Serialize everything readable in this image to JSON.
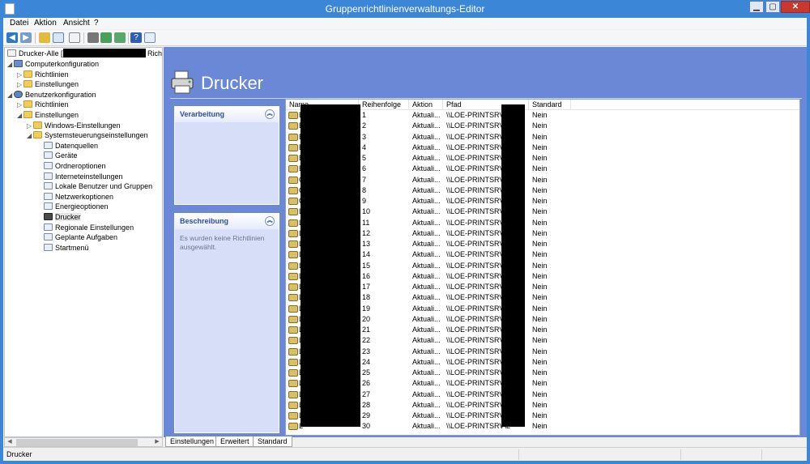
{
  "window": {
    "title": "Gruppenrichtlinienverwaltungs-Editor",
    "minimize": "▁",
    "maximize": "▢",
    "close": "✕"
  },
  "menu": {
    "items": [
      "Datei",
      "Aktion",
      "Ansicht",
      "?"
    ]
  },
  "toolbar": {
    "icons": [
      "back-icon",
      "forward-icon",
      "up-folder-icon",
      "show-hide-tree-icon",
      "clipboard-icon",
      "print-icon",
      "refresh-icon",
      "export-icon",
      "help-icon",
      "properties-icon"
    ]
  },
  "tree": {
    "root_prefix": "Drucker-Alle [",
    "root_suffix": "Richtli",
    "items": [
      {
        "label": "Computerkonfiguration",
        "icon": "computer-icon"
      },
      {
        "label": "Richtlinien",
        "icon": "folder-icon"
      },
      {
        "label": "Einstellungen",
        "icon": "folder-icon"
      },
      {
        "label": "Benutzerkonfiguration",
        "icon": "user-icon"
      },
      {
        "label": "Richtlinien",
        "icon": "folder-icon"
      },
      {
        "label": "Einstellungen",
        "icon": "folder-icon"
      },
      {
        "label": "Windows-Einstellungen",
        "icon": "folder-icon"
      },
      {
        "label": "Systemsteuerungseinstellungen",
        "icon": "folder-icon"
      },
      {
        "label": "Datenquellen",
        "icon": "datasource-icon"
      },
      {
        "label": "Geräte",
        "icon": "devices-icon"
      },
      {
        "label": "Ordneroptionen",
        "icon": "folder-options-icon"
      },
      {
        "label": "Interneteinstellungen",
        "icon": "internet-icon"
      },
      {
        "label": "Lokale Benutzer und Gruppen",
        "icon": "users-icon"
      },
      {
        "label": "Netzwerkoptionen",
        "icon": "network-icon"
      },
      {
        "label": "Energieoptionen",
        "icon": "power-icon"
      },
      {
        "label": "Drucker",
        "icon": "printer-icon"
      },
      {
        "label": "Regionale Einstellungen",
        "icon": "globe-icon"
      },
      {
        "label": "Geplante Aufgaben",
        "icon": "tasks-icon"
      },
      {
        "label": "Startmenü",
        "icon": "startmenu-icon"
      }
    ]
  },
  "content": {
    "title": "Drucker",
    "panels": {
      "processing_title": "Verarbeitung",
      "description_title": "Beschreibung",
      "description_text": "Es wurden keine Richtlinien ausgewählt."
    },
    "columns": [
      "Name",
      "Reihenfolge",
      "Aktion",
      "Pfad",
      "Standard"
    ],
    "rows": [
      {
        "name_initial": "B",
        "order": "1",
        "action": "Aktuali...",
        "path": "\\\\LOE-PRINTSRV\\B",
        "default": "Nein"
      },
      {
        "name_initial": "B",
        "order": "2",
        "action": "Aktuali...",
        "path": "\\\\LOE-PRINTSRV\\B",
        "default": "Nein"
      },
      {
        "name_initial": "B",
        "order": "3",
        "action": "Aktuali...",
        "path": "\\\\LOE-PRINTSRV\\B",
        "default": "Nein"
      },
      {
        "name_initial": "B",
        "order": "4",
        "action": "Aktuali...",
        "path": "\\\\LOE-PRINTSRV\\B",
        "default": "Nein"
      },
      {
        "name_initial": "B",
        "order": "5",
        "action": "Aktuali...",
        "path": "\\\\LOE-PRINTSRV\\B",
        "default": "Nein"
      },
      {
        "name_initial": "B",
        "order": "6",
        "action": "Aktuali...",
        "path": "\\\\LOE-PRINTSRV\\B",
        "default": "Nein"
      },
      {
        "name_initial": "G",
        "order": "7",
        "action": "Aktuali...",
        "path": "\\\\LOE-PRINTSRV\\G",
        "default": "Nein"
      },
      {
        "name_initial": "G",
        "order": "8",
        "action": "Aktuali...",
        "path": "\\\\LOE-PRINTSRV\\G",
        "default": "Nein"
      },
      {
        "name_initial": "G",
        "order": "9",
        "action": "Aktuali...",
        "path": "\\\\LOE-PRINTSRV\\G",
        "default": "Nein"
      },
      {
        "name_initial": "L",
        "order": "10",
        "action": "Aktuali...",
        "path": "\\\\LOE-PRINTSRV\\L",
        "default": "Nein"
      },
      {
        "name_initial": "L",
        "order": "11",
        "action": "Aktuali...",
        "path": "\\\\LOE-PRINTSRV\\L",
        "default": "Nein"
      },
      {
        "name_initial": "L",
        "order": "12",
        "action": "Aktuali...",
        "path": "\\\\LOE-PRINTSRV\\L",
        "default": "Nein"
      },
      {
        "name_initial": "L",
        "order": "13",
        "action": "Aktuali...",
        "path": "\\\\LOE-PRINTSRV\\L",
        "default": "Nein"
      },
      {
        "name_initial": "L",
        "order": "14",
        "action": "Aktuali...",
        "path": "\\\\LOE-PRINTSRV\\L",
        "default": "Nein"
      },
      {
        "name_initial": "L",
        "order": "15",
        "action": "Aktuali...",
        "path": "\\\\LOE-PRINTSRV\\L",
        "default": "Nein"
      },
      {
        "name_initial": "L",
        "order": "16",
        "action": "Aktuali...",
        "path": "\\\\LOE-PRINTSRV\\L",
        "default": "Nein"
      },
      {
        "name_initial": "L",
        "order": "17",
        "action": "Aktuali...",
        "path": "\\\\LOE-PRINTSRV\\L",
        "default": "Nein"
      },
      {
        "name_initial": "L",
        "order": "18",
        "action": "Aktuali...",
        "path": "\\\\LOE-PRINTSRV\\L",
        "default": "Nein"
      },
      {
        "name_initial": "L",
        "order": "19",
        "action": "Aktuali...",
        "path": "\\\\LOE-PRINTSRV\\L",
        "default": "Nein"
      },
      {
        "name_initial": "L",
        "order": "20",
        "action": "Aktuali...",
        "path": "\\\\LOE-PRINTSRV\\L",
        "default": "Nein"
      },
      {
        "name_initial": "L",
        "order": "21",
        "action": "Aktuali...",
        "path": "\\\\LOE-PRINTSRV\\L",
        "default": "Nein"
      },
      {
        "name_initial": "L",
        "order": "22",
        "action": "Aktuali...",
        "path": "\\\\LOE-PRINTSRV\\L",
        "default": "Nein"
      },
      {
        "name_initial": "L",
        "order": "23",
        "action": "Aktuali...",
        "path": "\\\\LOE-PRINTSRV\\L",
        "default": "Nein"
      },
      {
        "name_initial": "L",
        "order": "24",
        "action": "Aktuali...",
        "path": "\\\\LOE-PRINTSRV\\L",
        "default": "Nein"
      },
      {
        "name_initial": "B",
        "order": "25",
        "action": "Aktuali...",
        "path": "\\\\LOE-PRINTSRV\\B",
        "default": "Nein"
      },
      {
        "name_initial": "L",
        "order": "26",
        "action": "Aktuali...",
        "path": "\\\\LOE-PRINTSRV\\L",
        "default": "Nein"
      },
      {
        "name_initial": "L",
        "order": "27",
        "action": "Aktuali...",
        "path": "\\\\LOE-PRINTSRV\\L",
        "default": "Nein"
      },
      {
        "name_initial": "L",
        "order": "28",
        "action": "Aktuali...",
        "path": "\\\\LOE-PRINTSRV\\L",
        "default": "Nein"
      },
      {
        "name_initial": "L",
        "order": "29",
        "action": "Aktuali...",
        "path": "\\\\LOE-PRINTSRV\\L",
        "default": "Nein"
      },
      {
        "name_initial": "L",
        "order": "30",
        "action": "Aktuali...",
        "path": "\\\\LOE-PRINTSRV\\L",
        "default": "Nein"
      }
    ]
  },
  "tabs": [
    "Einstellungen",
    "Erweitert",
    "Standard"
  ],
  "statusbar": {
    "text": "Drucker"
  },
  "colors": {
    "title_bar": "#3c86d8",
    "content_background": "#6b88d7",
    "panel_background": "#d6dff7",
    "panel_heading": "#2b4ea8",
    "redaction": "#000000"
  }
}
